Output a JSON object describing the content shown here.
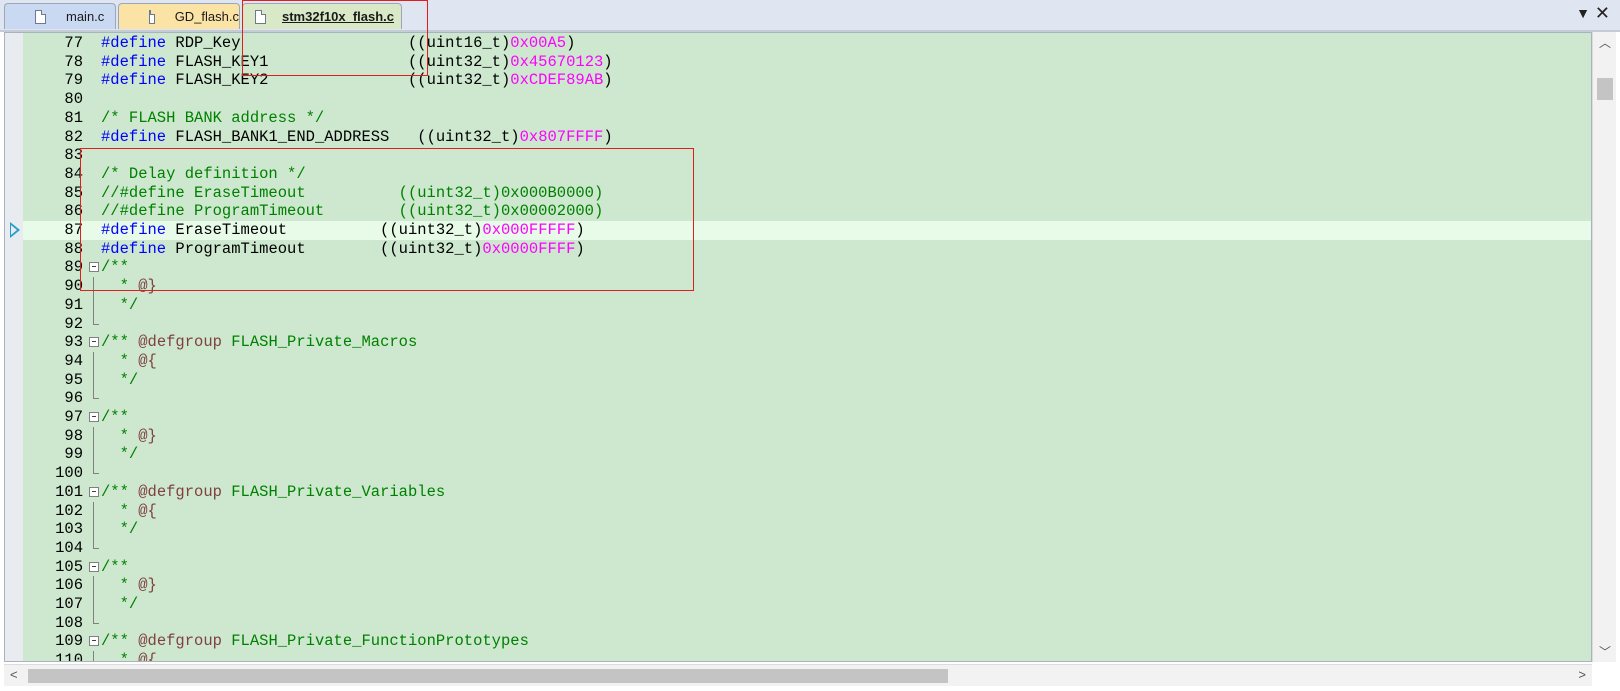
{
  "tabs": [
    {
      "label": "main.c"
    },
    {
      "label": "GD_flash.c"
    },
    {
      "label": "stm32f10x_flash.c"
    }
  ],
  "tab_menu_icon": "chevron-down-icon",
  "close_icon": "close-icon",
  "editor": {
    "colors": {
      "background": "#cde8cf",
      "keyword": "#0000ff",
      "comment": "#008000",
      "number": "#ff00ff",
      "current_line": "#e8fbe8",
      "annotation": "#e01e1e"
    },
    "lines": [
      {
        "n": "77",
        "text": "#define RDP_Key                  ((uint16_t)0x00A5)"
      },
      {
        "n": "78",
        "text": "#define FLASH_KEY1               ((uint32_t)0x45670123)"
      },
      {
        "n": "79",
        "text": "#define FLASH_KEY2               ((uint32_t)0xCDEF89AB)"
      },
      {
        "n": "80",
        "text": ""
      },
      {
        "n": "81",
        "text": "/* FLASH BANK address */"
      },
      {
        "n": "82",
        "text": "#define FLASH_BANK1_END_ADDRESS   ((uint32_t)0x807FFFF)"
      },
      {
        "n": "83",
        "text": ""
      },
      {
        "n": "84",
        "text": "/* Delay definition */"
      },
      {
        "n": "85",
        "text": "//#define EraseTimeout          ((uint32_t)0x000B0000)"
      },
      {
        "n": "86",
        "text": "//#define ProgramTimeout        ((uint32_t)0x00002000)"
      },
      {
        "n": "87",
        "text": "#define EraseTimeout          ((uint32_t)0x000FFFFF)"
      },
      {
        "n": "88",
        "text": "#define ProgramTimeout        ((uint32_t)0x0000FFFF)"
      },
      {
        "n": "89",
        "text": "/**"
      },
      {
        "n": "90",
        "text": "  * @}"
      },
      {
        "n": "91",
        "text": "  */"
      },
      {
        "n": "92",
        "text": ""
      },
      {
        "n": "93",
        "text": "/** @defgroup FLASH_Private_Macros"
      },
      {
        "n": "94",
        "text": "  * @{"
      },
      {
        "n": "95",
        "text": "  */"
      },
      {
        "n": "96",
        "text": ""
      },
      {
        "n": "97",
        "text": "/**"
      },
      {
        "n": "98",
        "text": "  * @}"
      },
      {
        "n": "99",
        "text": "  */"
      },
      {
        "n": "100",
        "text": ""
      },
      {
        "n": "101",
        "text": "/** @defgroup FLASH_Private_Variables"
      },
      {
        "n": "102",
        "text": "  * @{"
      },
      {
        "n": "103",
        "text": "  */"
      },
      {
        "n": "104",
        "text": ""
      },
      {
        "n": "105",
        "text": "/**"
      },
      {
        "n": "106",
        "text": "  * @}"
      },
      {
        "n": "107",
        "text": "  */"
      },
      {
        "n": "108",
        "text": ""
      },
      {
        "n": "109",
        "text": "/** @defgroup FLASH_Private_FunctionPrototypes"
      },
      {
        "n": "110",
        "text": "  * @{"
      }
    ],
    "current_line": "87"
  }
}
